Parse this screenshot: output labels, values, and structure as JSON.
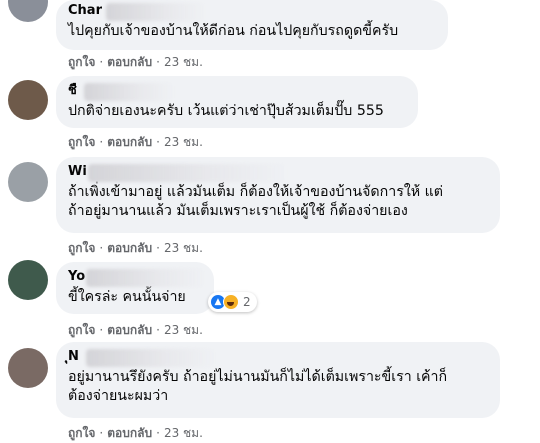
{
  "comments": [
    {
      "author": "Char",
      "text": "ไปคุยกับเจ้าของบ้านให้ดีก่อน ก่อนไปคุยกับรถดูดขี้ครับ",
      "avatar_color": "#8a8f99"
    },
    {
      "author": "ชื",
      "text": "ปกติจ่ายเองนะครับ เว้นแต่ว่าเช่าปุ๊บส้วมเต็มปั๊บ 555",
      "avatar_color": "#6e5a4a"
    },
    {
      "author": "Wi",
      "text_line1": "ถ้าเพิ่งเข้ามาอยู่ แล้วมันเต็ม ก็ต้องให้เจ้าของบ้านจัดการให้ แต่",
      "text_line2": "ถ้าอยู่มานานแล้ว มันเต็มเพราะเราเป็นผู้ใช้ ก็ต้องจ่ายเอง",
      "avatar_color": "#9aa0a6"
    },
    {
      "author": "Yo",
      "text": "ขี้ใครล่ะ คนนั้นจ่าย",
      "avatar_color": "#3f5a4c",
      "reaction_count": "2",
      "reaction_icons": [
        "like-icon",
        "haha-icon"
      ]
    },
    {
      "author": "ุN",
      "text_line1": "อยู่มานานรึยังครับ ถ้าอยู่ไม่นานมันก็ไม่ได้เต็มเพราะขี้เรา เค้าก็",
      "text_line2": "ต้องจ่ายนะผมว่า",
      "avatar_color": "#7a6a64"
    }
  ],
  "actions": {
    "like": "ถูกใจ",
    "reply": "ตอบกลับ",
    "separator": "·",
    "time": "23 ชม."
  },
  "colors": {
    "bubble": "#f0f2f5",
    "meta_text": "#65676b",
    "like_blue": "#1877f2"
  }
}
